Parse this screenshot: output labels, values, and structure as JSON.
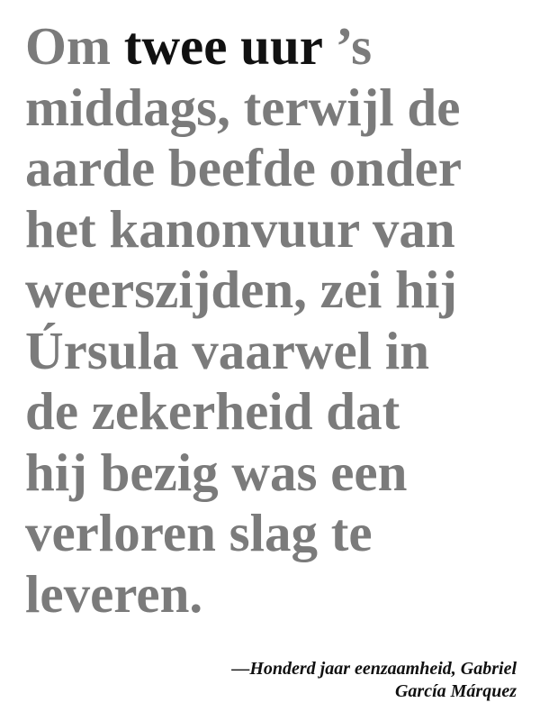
{
  "quote": {
    "line1": {
      "pre": "Om ",
      "highlight": "twee uur",
      "post": " ’s"
    },
    "lines": [
      "middags, terwijl de",
      "aarde beefde onder",
      "het kanonvuur van",
      "weerszijden, zei hij",
      "Úrsula vaarwel in",
      "de zekerheid dat",
      "hij bezig was een",
      "verloren slag te",
      "leveren."
    ]
  },
  "attribution": {
    "line1": "—Honderd jaar eenzaamheid, Gabriel",
    "line2": "García Márquez"
  },
  "colors": {
    "text_muted": "#7b7b7b",
    "text_highlight": "#111111",
    "background": "#ffffff"
  }
}
